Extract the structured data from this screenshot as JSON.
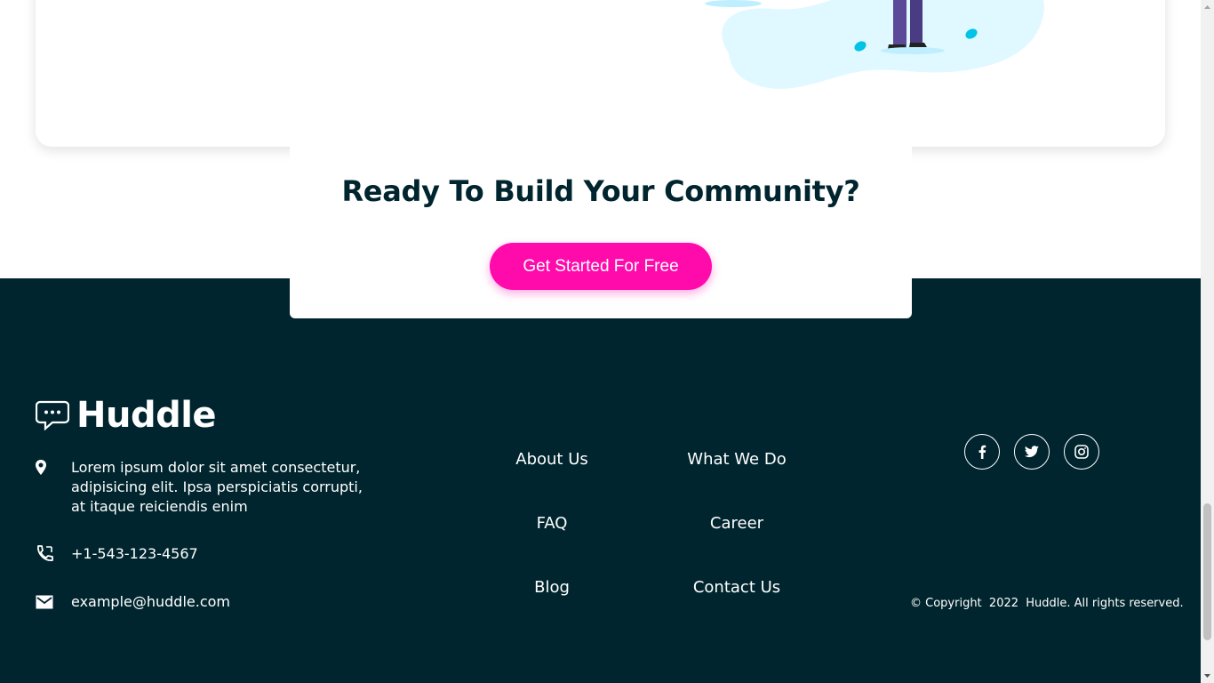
{
  "cta": {
    "title": "Ready To Build Your Community?",
    "button_label": "Get Started For Free"
  },
  "footer": {
    "brand": "Huddle",
    "address": "Lorem ipsum dolor sit amet consectetur, adipisicing elit. Ipsa perspiciatis corrupti, at itaque reiciendis enim",
    "phone": "+1-543-123-4567",
    "email": "example@huddle.com",
    "links": {
      "about": "About Us",
      "what_we_do": "What We Do",
      "faq": "FAQ",
      "career": "Career",
      "blog": "Blog",
      "contact": "Contact Us"
    },
    "social": [
      "facebook-icon",
      "twitter-icon",
      "instagram-icon"
    ],
    "copyright": "© Copyright  2022  Huddle. All rights reserved."
  },
  "colors": {
    "footer_bg": "#00252e",
    "accent": "#ff0bac",
    "heading": "#00252e",
    "illustration_blob": "#e0f8ff"
  }
}
